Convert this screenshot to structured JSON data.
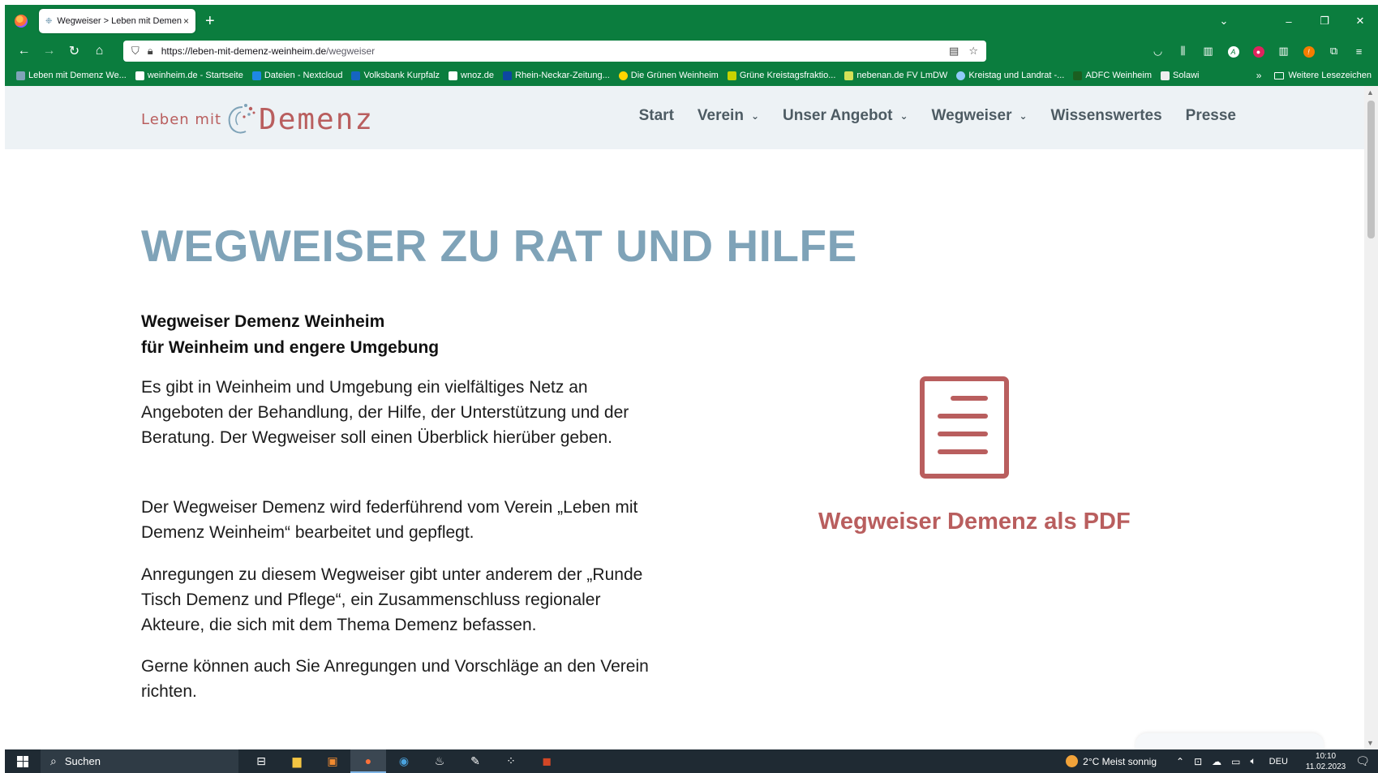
{
  "browser": {
    "tab_title": "Wegweiser > Leben mit Demenz",
    "tab_close": "×",
    "new_tab": "+",
    "url_host": "https://leben-mit-demenz-weinheim.de",
    "url_path": "/wegweiser",
    "bookmarks": [
      "Leben mit Demenz We...",
      "weinheim.de - Startseite",
      "Dateien - Nextcloud",
      "Volksbank Kurpfalz",
      "wnoz.de",
      "Rhein-Neckar-Zeitung...",
      "Die Grünen Weinheim",
      "Grüne Kreistagsfraktio...",
      "nebenan.de FV LmDW",
      "Kreistag und Landrat -...",
      "ADFC Weinheim",
      "Solawi"
    ],
    "bookmarks_other": "Weitere Lesezeichen",
    "accent_color": "#0b7d3e"
  },
  "site": {
    "logo_small": "Leben mit",
    "logo_big": "Demenz",
    "nav": [
      {
        "label": "Start"
      },
      {
        "label": "Verein"
      },
      {
        "label": "Unser Angebot"
      },
      {
        "label": "Wegweiser"
      },
      {
        "label": "Wissenswertes"
      },
      {
        "label": "Presse"
      }
    ],
    "brand_color": "#b95e5e",
    "heading_color": "#7fa3b8"
  },
  "main": {
    "title": "WEGWEISER ZU RAT UND HILFE",
    "lead_line1": "Wegweiser Demenz Weinheim",
    "lead_line2": "für Weinheim und engere Umgebung",
    "p1": "Es gibt in Weinheim und Umgebung ein vielfältiges Netz an Angeboten der Behandlung, der Hilfe, der Unterstützung und der Beratung. Der Wegweiser soll einen Überblick hierüber geben.",
    "p2": "Der Wegweiser Demenz wird federführend vom Verein „Leben mit Demenz Weinheim“ bearbeitet und gepflegt.",
    "p3": "Anregungen zu diesem Wegweiser gibt unter anderem der „Runde Tisch Demenz und Pflege“, ein Zusammenschluss regionaler Akteure, die sich mit dem Thema Demenz befassen.",
    "p4": "Gerne können auch Sie Anregungen und Vorschläge an den Verein richten.",
    "pdf_link": "Wegweiser Demenz als PDF"
  },
  "taskbar": {
    "search_label": "Suchen",
    "weather": "2°C  Meist sonnig",
    "language": "DEU",
    "time": "10:10",
    "date": "11.02.2023"
  }
}
